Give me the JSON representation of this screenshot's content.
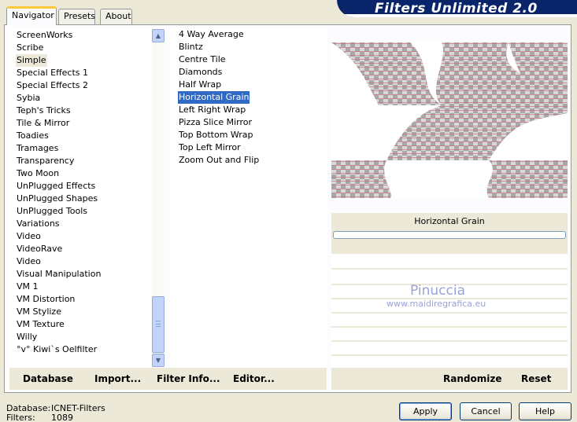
{
  "app_title": "Filters Unlimited 2.0",
  "tabs": [
    "Navigator",
    "Presets",
    "About"
  ],
  "categories": [
    "ScreenWorks",
    "Scribe",
    "Simple",
    "Special Effects 1",
    "Special Effects 2",
    "Sybia",
    "Teph's Tricks",
    "Tile & Mirror",
    "Toadies",
    "Tramages",
    "Transparency",
    "Two Moon",
    "UnPlugged Effects",
    "UnPlugged Shapes",
    "UnPlugged Tools",
    "Variations",
    "Video",
    "VideoRave",
    "Video",
    "Visual Manipulation",
    "VM 1",
    "VM Distortion",
    "VM Stylize",
    "VM Texture",
    "Willy",
    "°v° Kiwi`s Oelfilter"
  ],
  "selected_category": "Simple",
  "filters": [
    "4 Way Average",
    "Blintz",
    "Centre Tile",
    "Diamonds",
    "Half Wrap",
    "Horizontal Grain",
    "Left Right Wrap",
    "Pizza Slice Mirror",
    "Top Bottom Wrap",
    "Top Left Mirror",
    "Zoom Out and Flip"
  ],
  "selected_filter": "Horizontal Grain",
  "param_label": "Horizontal Grain",
  "watermark": {
    "name": "Pinuccia",
    "url": "www.maidiregrafica.eu"
  },
  "toolbar": {
    "database_label": "Database",
    "import_label": "Import...",
    "filter_info_label": "Filter Info...",
    "editor_label": "Editor...",
    "randomize_label": "Randomize",
    "reset_label": "Reset"
  },
  "status": {
    "database_key": "Database:",
    "database_value": "ICNET-Filters",
    "filters_key": "Filters:",
    "filters_value": "1089"
  },
  "buttons": {
    "apply": "Apply",
    "cancel": "Cancel",
    "help": "Help"
  },
  "colors": {
    "selection": "#316ac5",
    "banner": "#0a246a",
    "tab_highlight": "#ffc83c"
  }
}
